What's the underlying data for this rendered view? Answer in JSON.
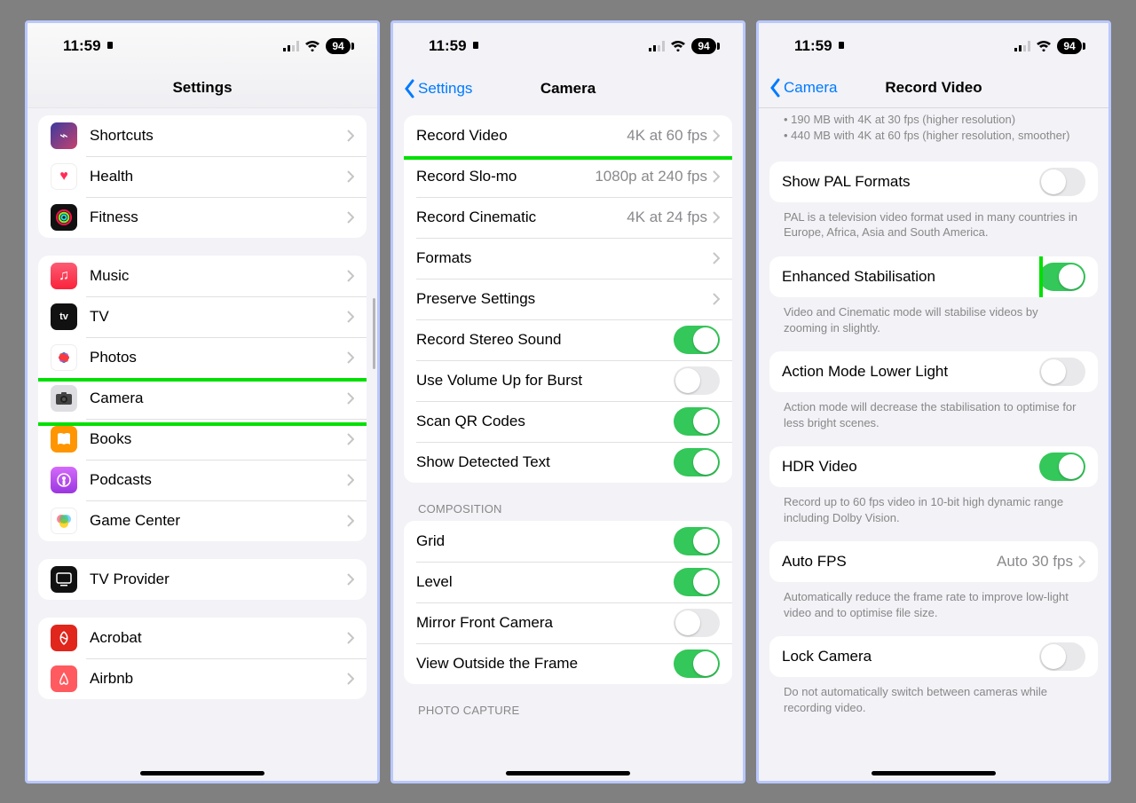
{
  "status": {
    "time": "11:59",
    "battery": "94"
  },
  "phone1": {
    "title": "Settings",
    "section1": [
      {
        "name": "shortcuts",
        "label": "Shortcuts"
      },
      {
        "name": "health",
        "label": "Health"
      },
      {
        "name": "fitness",
        "label": "Fitness"
      }
    ],
    "section2": [
      {
        "name": "music",
        "label": "Music"
      },
      {
        "name": "tv",
        "label": "TV"
      },
      {
        "name": "photos",
        "label": "Photos"
      },
      {
        "name": "camera",
        "label": "Camera",
        "highlight": true
      },
      {
        "name": "books",
        "label": "Books"
      },
      {
        "name": "podcasts",
        "label": "Podcasts"
      },
      {
        "name": "gamecenter",
        "label": "Game Center"
      }
    ],
    "section3": [
      {
        "name": "tvprovider",
        "label": "TV Provider"
      }
    ],
    "section4": [
      {
        "name": "acrobat",
        "label": "Acrobat"
      },
      {
        "name": "airbnb",
        "label": "Airbnb"
      }
    ]
  },
  "phone2": {
    "back": "Settings",
    "title": "Camera",
    "rows": {
      "recordVideo": {
        "label": "Record Video",
        "value": "4K at 60 fps"
      },
      "recordSlomo": {
        "label": "Record Slo-mo",
        "value": "1080p at 240 fps"
      },
      "recordCinematic": {
        "label": "Record Cinematic",
        "value": "4K at 24 fps"
      },
      "formats": {
        "label": "Formats"
      },
      "preserve": {
        "label": "Preserve Settings"
      },
      "stereo": {
        "label": "Record Stereo Sound"
      },
      "volburst": {
        "label": "Use Volume Up for Burst"
      },
      "qr": {
        "label": "Scan QR Codes"
      },
      "detected": {
        "label": "Show Detected Text"
      }
    },
    "compositionHeader": "COMPOSITION",
    "composition": {
      "grid": {
        "label": "Grid"
      },
      "level": {
        "label": "Level"
      },
      "mirror": {
        "label": "Mirror Front Camera"
      },
      "outside": {
        "label": "View Outside the Frame"
      }
    },
    "photoCaptureHeader": "PHOTO CAPTURE"
  },
  "phone3": {
    "back": "Camera",
    "title": "Record Video",
    "intro": [
      "190 MB with 4K at 30 fps (higher resolution)",
      "440 MB with 4K at 60 fps (higher resolution, smoother)"
    ],
    "pal": {
      "label": "Show PAL Formats",
      "footer": "PAL is a television video format used in many countries in Europe, Africa, Asia and South America."
    },
    "stab": {
      "label": "Enhanced Stabilisation",
      "footer": "Video and Cinematic mode will stabilise videos by zooming in slightly."
    },
    "action": {
      "label": "Action Mode Lower Light",
      "footer": "Action mode will decrease the stabilisation to optimise for less bright scenes."
    },
    "hdr": {
      "label": "HDR Video",
      "footer": "Record up to 60 fps video in 10-bit high dynamic range including Dolby Vision."
    },
    "autofps": {
      "label": "Auto FPS",
      "value": "Auto 30 fps",
      "footer": "Automatically reduce the frame rate to improve low-light video and to optimise file size."
    },
    "lock": {
      "label": "Lock Camera",
      "footer": "Do not automatically switch between cameras while recording video."
    }
  }
}
